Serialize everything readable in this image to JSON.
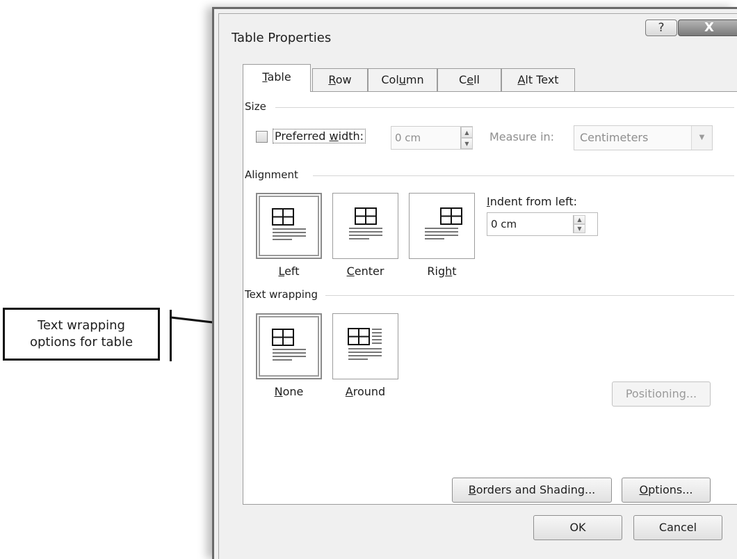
{
  "callout": {
    "line1": "Text wrapping",
    "line2": "options for table"
  },
  "window": {
    "title": "Table Properties",
    "help_glyph": "?",
    "close_glyph": "X"
  },
  "tabs": [
    {
      "pre": "",
      "key": "T",
      "post": "able",
      "active": true
    },
    {
      "pre": "",
      "key": "R",
      "post": "ow",
      "active": false
    },
    {
      "pre": "Col",
      "key": "u",
      "post": "mn",
      "active": false
    },
    {
      "pre": "C",
      "key": "e",
      "post": "ll",
      "active": false
    },
    {
      "pre": "",
      "key": "A",
      "post": "lt Text",
      "active": false
    }
  ],
  "size": {
    "section_label": "Size",
    "preferred_width": {
      "pre": "Preferred ",
      "key": "w",
      "post": "idth:",
      "checked": false
    },
    "width_value": "0 cm",
    "measure_in_label": "Measure in:",
    "measure_in_value": "Centimeters"
  },
  "alignment": {
    "section_label": "Alignment",
    "options": [
      {
        "pre": "",
        "key": "L",
        "post": "eft",
        "selected": true
      },
      {
        "pre": "",
        "key": "C",
        "post": "enter",
        "selected": false
      },
      {
        "pre": "Rig",
        "key": "h",
        "post": "t",
        "selected": false
      }
    ],
    "indent_label": {
      "pre": "",
      "key": "I",
      "post": "ndent from left:"
    },
    "indent_value": "0 cm"
  },
  "text_wrapping": {
    "section_label": "Text wrapping",
    "options": [
      {
        "pre": "",
        "key": "N",
        "post": "one",
        "selected": true
      },
      {
        "pre": "",
        "key": "A",
        "post": "round",
        "selected": false
      }
    ],
    "positioning_button": "Positioning..."
  },
  "buttons": {
    "borders_shading": {
      "pre": "",
      "key": "B",
      "post": "orders and Shading..."
    },
    "options": {
      "pre": "",
      "key": "O",
      "post": "ptions..."
    },
    "ok": "OK",
    "cancel": "Cancel"
  }
}
